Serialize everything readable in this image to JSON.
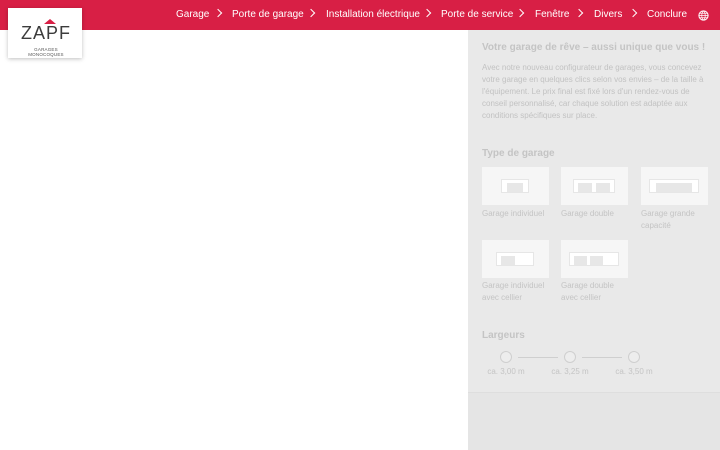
{
  "nav": {
    "items": [
      {
        "label": "Garage"
      },
      {
        "label": "Porte de garage"
      },
      {
        "label": "Installation électrique"
      },
      {
        "label": "Porte de service"
      },
      {
        "label": "Fenêtre"
      },
      {
        "label": "Divers"
      },
      {
        "label": "Conclure"
      }
    ],
    "language_icon": "globe-icon"
  },
  "logo": {
    "wordmark": "ZAPF",
    "tagline": "GARAGES MONOCOQUES"
  },
  "panel": {
    "title": "Votre garage de rêve – aussi unique que vous !",
    "intro": "Avec notre nouveau configurateur de garages, vous concevez votre garage en quelques clics selon vos envies – de la taille à l'équipement. Le prix final est fixé lors d'un rendez-vous de conseil personnalisé, car chaque solution est adaptée aux conditions spécifiques sur place.",
    "type_heading": "Type de garage",
    "types": [
      {
        "label": "Garage individuel"
      },
      {
        "label": "Garage double"
      },
      {
        "label": "Garage grande capacité"
      },
      {
        "label": "Garage individuel avec cellier"
      },
      {
        "label": "Garage double avec cellier"
      }
    ],
    "widths_heading": "Largeurs",
    "widths": [
      {
        "label": "ca. 3,00 m"
      },
      {
        "label": "ca. 3,25 m"
      },
      {
        "label": "ca. 3,50 m"
      }
    ]
  },
  "colors": {
    "brand": "#d81f45",
    "panel_bg": "#e9e9e9",
    "muted_text": "#c4c4c4"
  }
}
